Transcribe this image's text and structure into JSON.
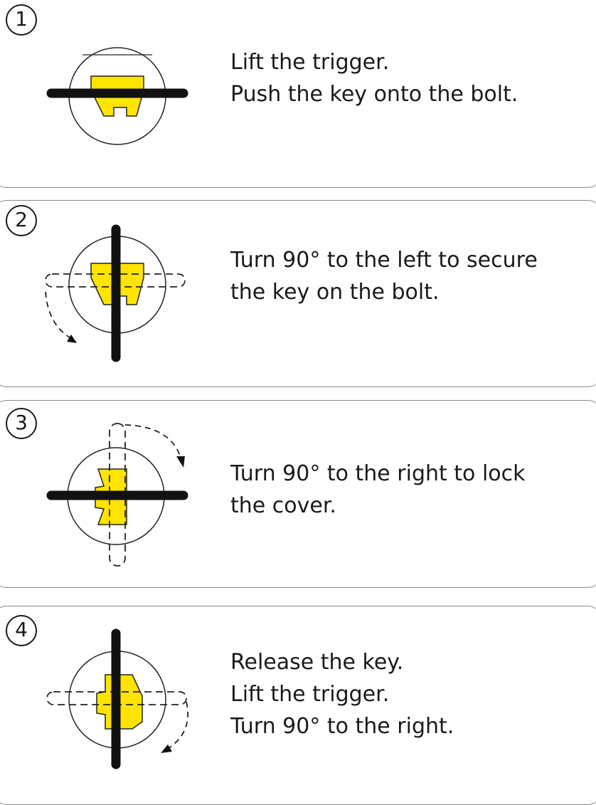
{
  "steps": [
    {
      "number": "1",
      "lines": [
        "Lift the trigger.",
        "Push the key onto the bolt."
      ]
    },
    {
      "number": "2",
      "lines": [
        "Turn 90° to the left to secure",
        "the key on the bolt."
      ]
    },
    {
      "number": "3",
      "lines": [
        "Turn 90° to the right to lock",
        "the cover."
      ]
    },
    {
      "number": "4",
      "lines": [
        "Release the key.",
        "Lift the trigger.",
        "Turn 90° to the right."
      ]
    }
  ],
  "colors": {
    "bolt_yellow": "#FFE400",
    "key_black": "#111111",
    "panel_border": "#8a8a8a"
  }
}
